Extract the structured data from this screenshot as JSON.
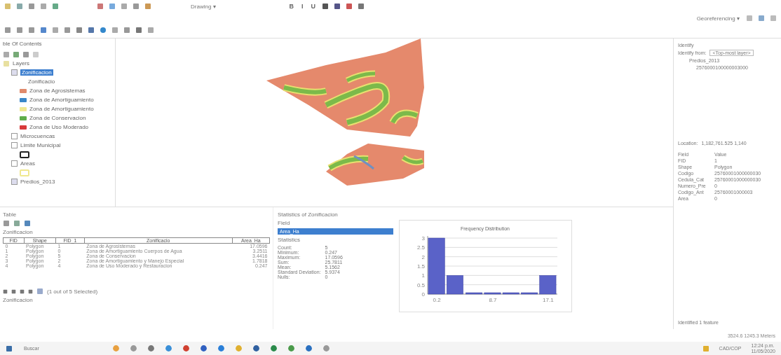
{
  "toolbar": {
    "menus": [
      {
        "label": "Drawing ▾"
      },
      {
        "label": "Georeferencing ▾"
      }
    ],
    "format_buttons": [
      "B",
      "I",
      "U"
    ]
  },
  "toc": {
    "title": "ble Of Contents",
    "root": "Layers",
    "layers": [
      {
        "name": "Zonificacion",
        "checked": true,
        "selected": true,
        "field": "Zonificacio",
        "legend": [
          {
            "label": "Zona de Agrosistemas",
            "color": "#e08a6c"
          },
          {
            "label": "Zona de Amortiguamiento",
            "color": "#3a87c8"
          },
          {
            "label": "Zona de Amortiguamiento",
            "color": "#f0e890"
          },
          {
            "label": "Zona de Conservacion",
            "color": "#5fae4a"
          },
          {
            "label": "Zona de Uso Moderado",
            "color": "#d83a3a"
          }
        ]
      },
      {
        "name": "Microcuencas",
        "checked": false,
        "selected": false
      },
      {
        "name": "Limite Municipal",
        "checked": false,
        "selected": false,
        "color": "#222222"
      },
      {
        "name": "Areas",
        "checked": false,
        "selected": false,
        "color": "#f0e890"
      },
      {
        "name": "Predios_2013",
        "checked": true,
        "selected": false
      }
    ]
  },
  "table": {
    "title": "Table",
    "layer": "Zonificacion",
    "columns": [
      "FID",
      "Shape",
      "FID_1",
      "Zonificacio",
      "Area_Ha"
    ],
    "rows": [
      [
        "0",
        "Polygon",
        "1",
        "Zona de Agrosistemas",
        "17.0596"
      ],
      [
        "1",
        "Polygon",
        "0",
        "Zona de Amortiguamiento Cuerpos de Agua",
        "3.2511"
      ],
      [
        "2",
        "Polygon",
        "5",
        "Zona de Conservacion",
        "3.4416"
      ],
      [
        "3",
        "Polygon",
        "2",
        "Zona de Amortiguamiento y Manejo Especial",
        "1.7818"
      ],
      [
        "4",
        "Polygon",
        "4",
        "Zona de Uso Moderado y Restauracion",
        "0.247"
      ]
    ],
    "record": "(1 out of 5 Selected)",
    "tab": "Zonificacion"
  },
  "statistics": {
    "title": "Statistics of Zonificacion",
    "field_label": "Field",
    "field_value": "Area_Ha",
    "section": "Statistics",
    "items": [
      {
        "name": "Count:",
        "value": "5"
      },
      {
        "name": "Minimum:",
        "value": "0.247"
      },
      {
        "name": "Maximum:",
        "value": "17.0596"
      },
      {
        "name": "Sum:",
        "value": "25.7811"
      },
      {
        "name": "Mean:",
        "value": "5.1562"
      },
      {
        "name": "Standard Deviation:",
        "value": "5.9374"
      },
      {
        "name": "Nulls:",
        "value": "0"
      }
    ],
    "chart_data": {
      "type": "bar",
      "title": "Frequency Distribution",
      "x": [
        0.2,
        3.0,
        5.9,
        8.7,
        11.5,
        14.3,
        17.1
      ],
      "values": [
        3,
        1,
        0,
        0,
        0,
        0,
        1
      ],
      "xlim": [
        -1.2,
        18.5
      ],
      "ylim": [
        0,
        3
      ],
      "yticks": [
        0,
        0.5,
        1,
        1.5,
        2,
        2.5,
        3
      ],
      "xticks": [
        0.2,
        8.7,
        17.1
      ],
      "grid": true
    }
  },
  "identify": {
    "title": "Identify",
    "from_label": "Identify from:",
    "from_value": "<Top-most layer>",
    "layer": "Predios_2013",
    "feature": "2576000100000003000",
    "location_label": "Location:",
    "location_value": "1,182,761.525 1,140",
    "fields": [
      {
        "name": "Field",
        "value": "Value"
      },
      {
        "name": "FID",
        "value": "1"
      },
      {
        "name": "Shape",
        "value": "Polygon"
      },
      {
        "name": "Codigo",
        "value": "25760001000000030"
      },
      {
        "name": "Cedula_Cat",
        "value": "25760001000000030"
      },
      {
        "name": "Numero_Pre",
        "value": "0"
      },
      {
        "name": "Codigo_Ant",
        "value": "25760001000003"
      },
      {
        "name": "Area",
        "value": "0"
      }
    ],
    "status": "Identified 1 feature"
  },
  "status_bar": "3524.6  1245.3 Meters",
  "taskbar": {
    "search_placeholder": "Buscar",
    "tray_label": "CAD/COP",
    "time": "12:24 p.m.",
    "date": "11/05/2020"
  }
}
